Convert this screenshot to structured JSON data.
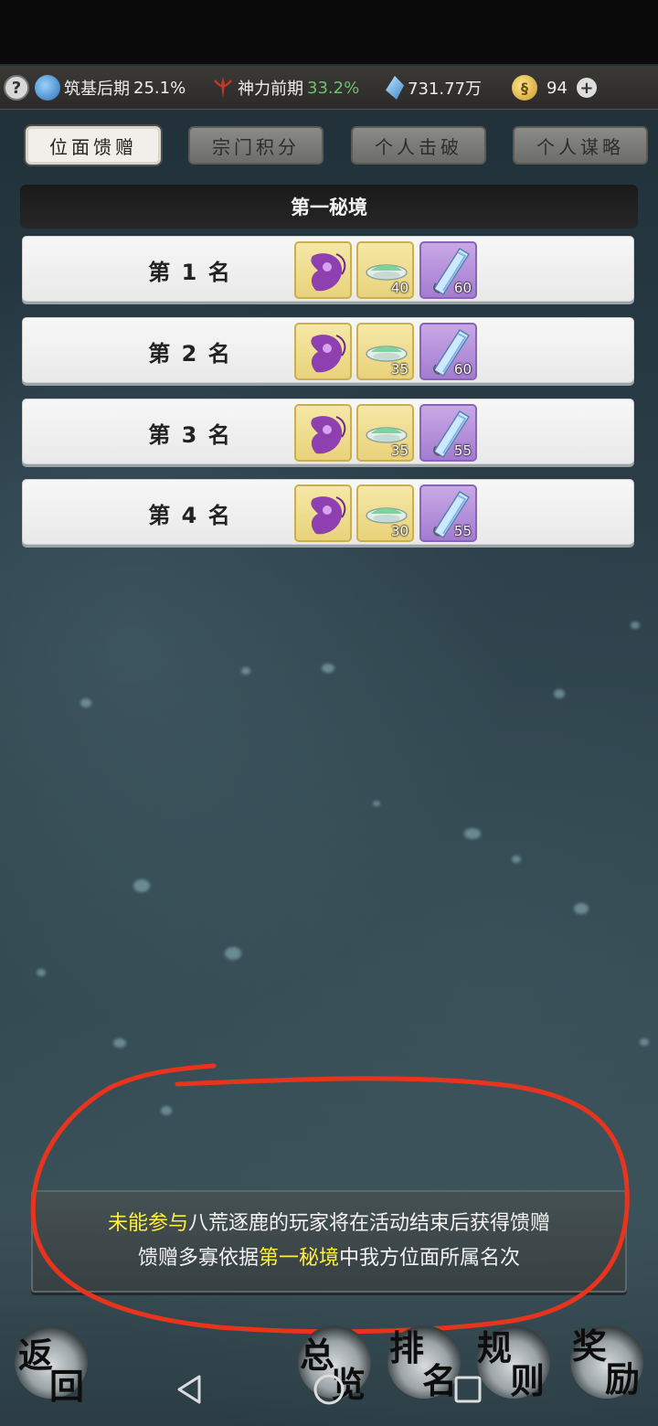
{
  "resources": {
    "realm_label": "筑基后期",
    "realm_value": "25.1%",
    "divine_label": "神力前期",
    "divine_value": "33.2%",
    "spirit_stones": "731.77万",
    "coins": "94"
  },
  "tabs": [
    {
      "label": "位面馈赠",
      "active": true
    },
    {
      "label": "宗门积分",
      "active": false
    },
    {
      "label": "个人击破",
      "active": false
    },
    {
      "label": "个人谋略",
      "active": false
    }
  ],
  "section_title": "第一秘境",
  "ranks": [
    {
      "label": "第 1 名",
      "items": [
        {
          "icon": "purple-spirit-icon",
          "qty": ""
        },
        {
          "icon": "jade-bowl-icon",
          "qty": "40"
        },
        {
          "icon": "crystal-blade-icon",
          "qty": "60"
        }
      ]
    },
    {
      "label": "第 2 名",
      "items": [
        {
          "icon": "purple-spirit-icon",
          "qty": ""
        },
        {
          "icon": "jade-bowl-icon",
          "qty": "35"
        },
        {
          "icon": "crystal-blade-icon",
          "qty": "60"
        }
      ]
    },
    {
      "label": "第 3 名",
      "items": [
        {
          "icon": "purple-spirit-icon",
          "qty": ""
        },
        {
          "icon": "jade-bowl-icon",
          "qty": "35"
        },
        {
          "icon": "crystal-blade-icon",
          "qty": "55"
        }
      ]
    },
    {
      "label": "第 4 名",
      "items": [
        {
          "icon": "purple-spirit-icon",
          "qty": ""
        },
        {
          "icon": "jade-bowl-icon",
          "qty": "30"
        },
        {
          "icon": "crystal-blade-icon",
          "qty": "55"
        }
      ]
    }
  ],
  "notice": {
    "line1_highlight": "未能参与",
    "line1_rest": "八荒逐鹿的玩家将在活动结束后获得馈赠",
    "line2_pre": "馈赠多寡依据",
    "line2_highlight": "第一秘境",
    "line2_post": "中我方位面所属名次"
  },
  "bottom_buttons": {
    "back": [
      "返",
      "回"
    ],
    "overview": [
      "总",
      "览"
    ],
    "ranking": [
      "排",
      "名"
    ],
    "rules": [
      "规",
      "则"
    ],
    "rewards": [
      "奖",
      "励"
    ]
  },
  "colors": {
    "highlight": "#ffee3a",
    "green_percent": "#6cc26c",
    "annotation_red": "#e8341c",
    "item_gold": "#f5e8a6",
    "item_purple": "#c9a8e6"
  }
}
